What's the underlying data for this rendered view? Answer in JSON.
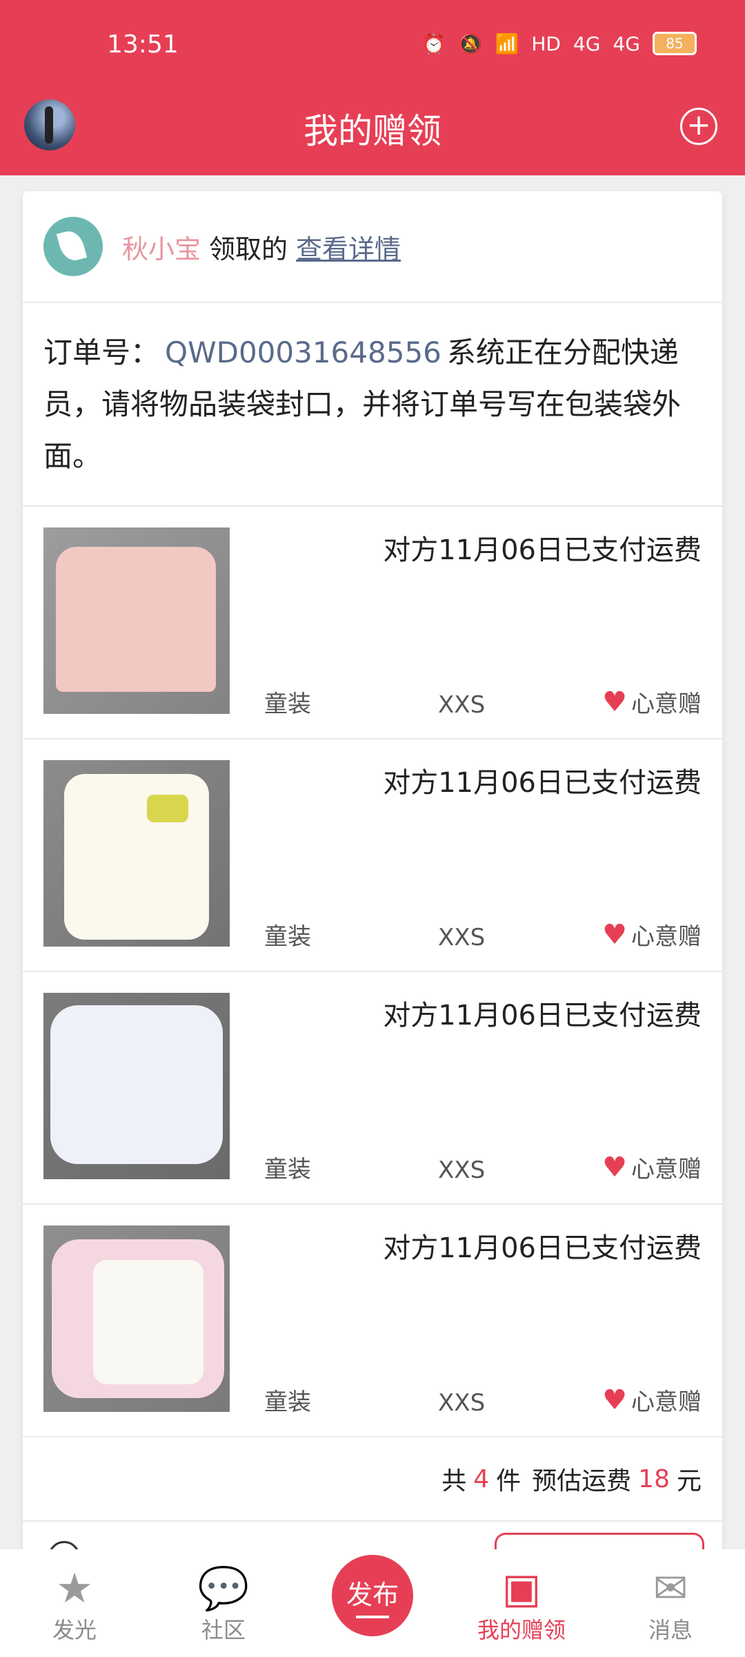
{
  "status_bar": {
    "time": "13:51",
    "battery": "85"
  },
  "header": {
    "title": "我的赠领",
    "add_icon": "plus-circle-icon"
  },
  "card": {
    "claimer": "秋小宝",
    "claim_text": "领取的",
    "detail_link": "查看详情",
    "order_label": "订单号：",
    "order_no": "QWD00031648556",
    "order_message": "系统正在分配快递员，请将物品装袋封口，并将订单号写在包装袋外面。",
    "items": [
      {
        "status": "对方11月06日已支付运费",
        "category": "童装",
        "size": "XXS",
        "type": "心意赠"
      },
      {
        "status": "对方11月06日已支付运费",
        "category": "童装",
        "size": "XXS",
        "type": "心意赠"
      },
      {
        "status": "对方11月06日已支付运费",
        "category": "童装",
        "size": "XXS",
        "type": "心意赠"
      },
      {
        "status": "对方11月06日已支付运费",
        "category": "童装",
        "size": "XXS",
        "type": "心意赠"
      }
    ],
    "summary": {
      "prefix": "共",
      "count": "4",
      "count_unit": "件",
      "fee_label": "预估运费",
      "fee": "18",
      "fee_unit": "元"
    }
  },
  "bottom_nav": [
    {
      "label": "发光",
      "icon": "star-icon"
    },
    {
      "label": "社区",
      "icon": "chat-bubble-icon"
    },
    {
      "label": "发布",
      "icon": "publish-icon"
    },
    {
      "label": "我的赠领",
      "icon": "gift-box-icon"
    },
    {
      "label": "消息",
      "icon": "mail-icon"
    }
  ],
  "colors": {
    "accent": "#e63f55",
    "link": "#5a6a8a",
    "claimer": "#e8959f"
  }
}
